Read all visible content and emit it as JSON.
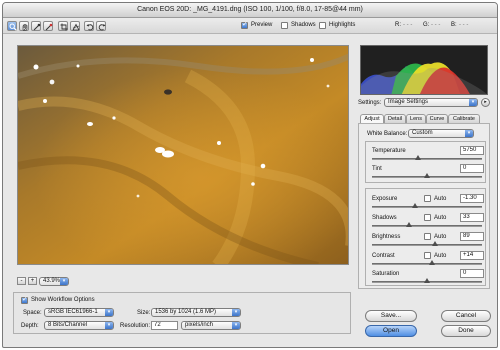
{
  "window": {
    "title": "Canon EOS 20D:  _MG_4191.dng  (ISO 100, 1/100, f/8.0, 17-85@44 mm)"
  },
  "toolbar": {
    "tools": [
      "zoom-tool",
      "hand-tool",
      "white-balance-tool",
      "color-sampler-tool",
      "crop-tool",
      "straighten-tool",
      "rotate-left-tool",
      "rotate-right-tool"
    ],
    "preview_label": "Preview",
    "preview_checked": true,
    "shadows_label": "Shadows",
    "shadows_checked": false,
    "highlights_label": "Highlights",
    "highlights_checked": false
  },
  "readout": {
    "r": "R:",
    "g": "G:",
    "b": "B:",
    "r_value": "- - -",
    "g_value": "- - -",
    "b_value": "- - -"
  },
  "zoom": {
    "minus": "-",
    "plus": "+",
    "value": "43.9%"
  },
  "settings": {
    "label": "Settings:",
    "value": "Image Settings"
  },
  "tabs": [
    "Adjust",
    "Detail",
    "Lens",
    "Curve",
    "Calibrate"
  ],
  "adjust": {
    "white_balance_label": "White Balance:",
    "white_balance_value": "Custom",
    "temperature_label": "Temperature",
    "temperature_value": "5750",
    "tint_label": "Tint",
    "tint_value": "0",
    "exposure_label": "Exposure",
    "exposure_value": "-1.30",
    "shadows_label": "Shadows",
    "shadows_value": "33",
    "brightness_label": "Brightness",
    "brightness_value": "89",
    "contrast_label": "Contrast",
    "contrast_value": "+14",
    "saturation_label": "Saturation",
    "saturation_value": "0",
    "auto_label": "Auto"
  },
  "workflow": {
    "show_label": "Show Workflow Options",
    "show_checked": true,
    "space_label": "Space:",
    "space_value": "sRGB IEC61966-1",
    "size_label": "Size:",
    "size_value": "1536 by 1024  (1.6 MP)",
    "depth_label": "Depth:",
    "depth_value": "8 Bits/Channel",
    "resolution_label": "Resolution:",
    "resolution_value": "72",
    "resolution_unit": "pixels/inch"
  },
  "buttons": {
    "save": "Save...",
    "cancel": "Cancel",
    "open": "Open",
    "done": "Done"
  },
  "colors": {
    "accent": "#4f8ee3",
    "window_bg": "#e8e8e8",
    "photo_sand": "#b07a22"
  }
}
